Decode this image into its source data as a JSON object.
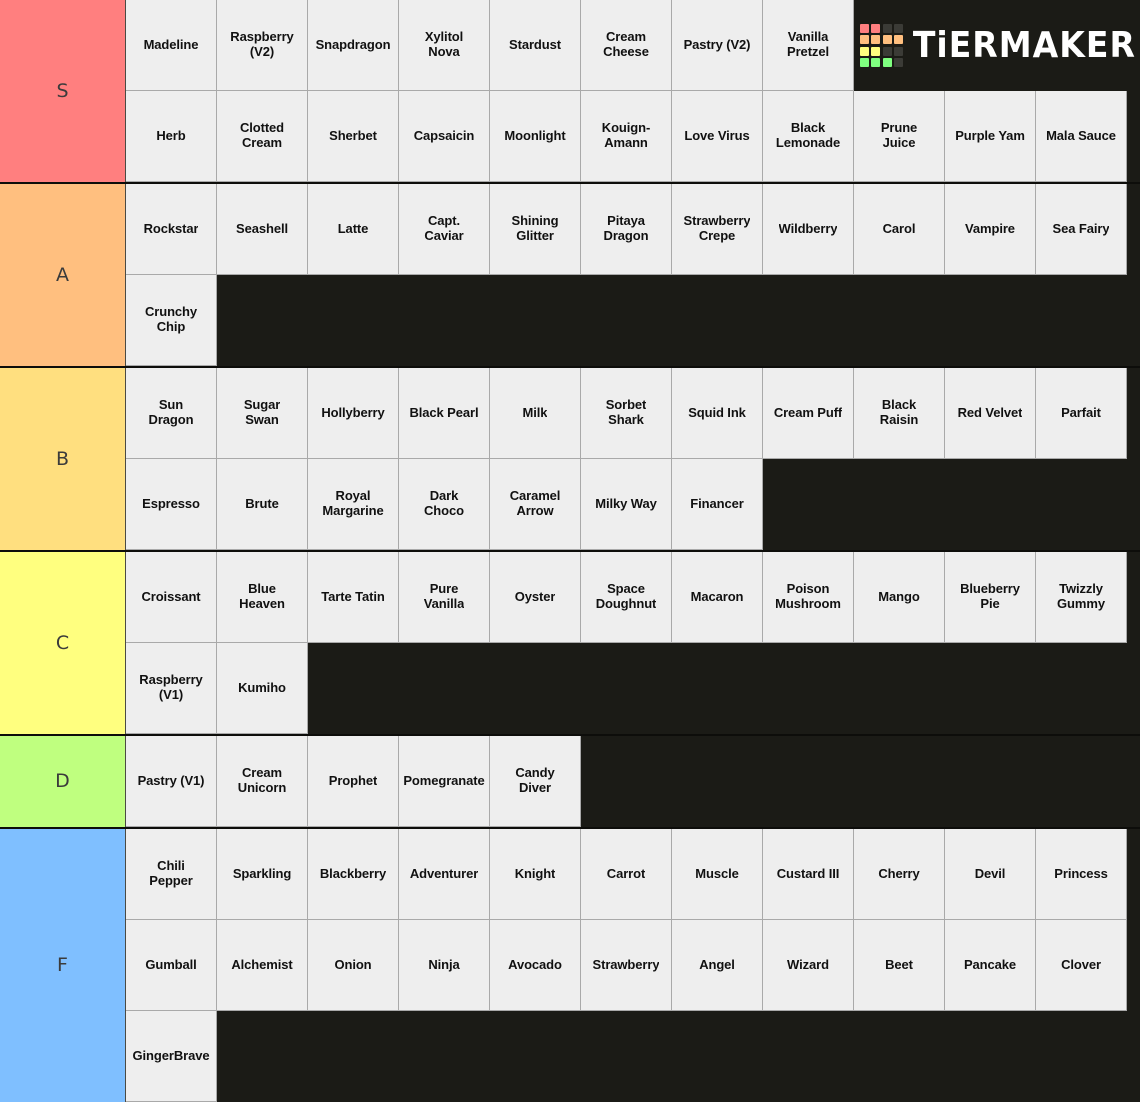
{
  "app": {
    "name": "TierMaker",
    "logo_text": "TiERMAKER",
    "logo_grid": [
      [
        "red",
        "red",
        "dark",
        "dark"
      ],
      [
        "orange",
        "orange",
        "orange",
        "orange"
      ],
      [
        "yellow",
        "yellow",
        "dark",
        "dark"
      ],
      [
        "green",
        "green",
        "green",
        "dark"
      ]
    ],
    "logo_colors": {
      "red": "#FF7F7F",
      "orange": "#FFBF7F",
      "yellow": "#FFFF7F",
      "green": "#7FFF7F",
      "dark": "#3b3b36"
    }
  },
  "background_color": "#1b1b16",
  "cell_color": "#eeeeee",
  "tiers": [
    {
      "label": "S",
      "color": "#FF7F7F",
      "rows": [
        [
          "Madeline",
          "Raspberry\n(V2)",
          "Snapdragon",
          "Xylitol\nNova",
          "Stardust",
          "Cream\nCheese",
          "Pastry (V2)",
          "Vanilla\nPretzel"
        ],
        [
          "Herb",
          "Clotted\nCream",
          "Sherbet",
          "Capsaicin",
          "Moonlight",
          "Kouign-\nAmann",
          "Love Virus",
          "Black\nLemonade",
          "Prune\nJuice",
          "Purple Yam",
          "Mala Sauce"
        ]
      ],
      "logo_row": 0
    },
    {
      "label": "A",
      "color": "#FFBF7F",
      "rows": [
        [
          "Rockstar",
          "Seashell",
          "Latte",
          "Capt.\nCaviar",
          "Shining\nGlitter",
          "Pitaya\nDragon",
          "Strawberry\nCrepe",
          "Wildberry",
          "Carol",
          "Vampire",
          "Sea Fairy"
        ],
        [
          "Crunchy\nChip"
        ]
      ]
    },
    {
      "label": "B",
      "color": "#FFDF7F",
      "rows": [
        [
          "Sun\nDragon",
          "Sugar\nSwan",
          "Hollyberry",
          "Black Pearl",
          "Milk",
          "Sorbet\nShark",
          "Squid Ink",
          "Cream Puff",
          "Black\nRaisin",
          "Red Velvet",
          "Parfait"
        ],
        [
          "Espresso",
          "Brute",
          "Royal\nMargarine",
          "Dark\nChoco",
          "Caramel\nArrow",
          "Milky Way",
          "Financer"
        ]
      ]
    },
    {
      "label": "C",
      "color": "#FFFF7F",
      "rows": [
        [
          "Croissant",
          "Blue\nHeaven",
          "Tarte Tatin",
          "Pure\nVanilla",
          "Oyster",
          "Space\nDoughnut",
          "Macaron",
          "Poison\nMushroom",
          "Mango",
          "Blueberry\nPie",
          "Twizzly\nGummy"
        ],
        [
          "Raspberry\n(V1)",
          "Kumiho"
        ]
      ]
    },
    {
      "label": "D",
      "color": "#BFFF7F",
      "rows": [
        [
          "Pastry (V1)",
          "Cream\nUnicorn",
          "Prophet",
          "Pomegranate",
          "Candy\nDiver"
        ]
      ]
    },
    {
      "label": "F",
      "color": "#7FBFFF",
      "rows": [
        [
          "Chili\nPepper",
          "Sparkling",
          "Blackberry",
          "Adventurer",
          "Knight",
          "Carrot",
          "Muscle",
          "Custard III",
          "Cherry",
          "Devil",
          "Princess"
        ],
        [
          "Gumball",
          "Alchemist",
          "Onion",
          "Ninja",
          "Avocado",
          "Strawberry",
          "Angel",
          "Wizard",
          "Beet",
          "Pancake",
          "Clover"
        ],
        [
          "GingerBrave"
        ]
      ]
    }
  ]
}
